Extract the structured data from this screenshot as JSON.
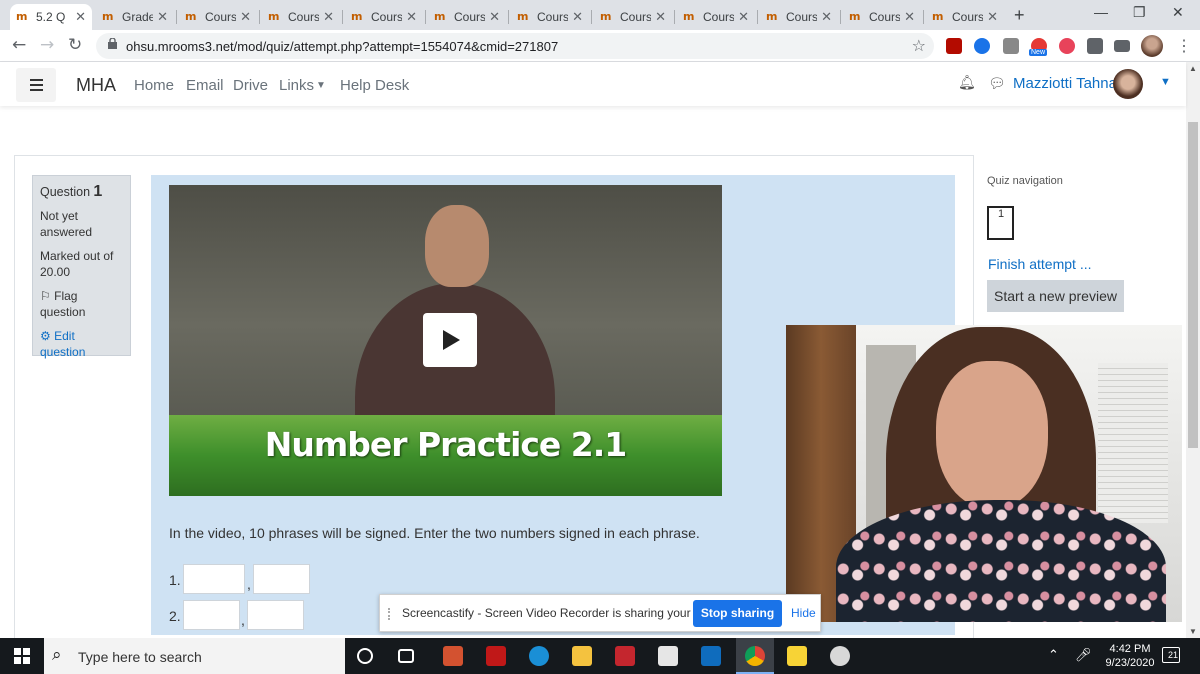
{
  "browser": {
    "tabs": [
      {
        "label": "5.2 Q"
      },
      {
        "label": "Grade"
      },
      {
        "label": "Cours"
      },
      {
        "label": "Cours"
      },
      {
        "label": "Cours"
      },
      {
        "label": "Cours"
      },
      {
        "label": "Cours"
      },
      {
        "label": "Cours"
      },
      {
        "label": "Cours"
      },
      {
        "label": "Cours"
      },
      {
        "label": "Cours"
      },
      {
        "label": "Cours"
      }
    ],
    "url": "ohsu.mrooms3.net/mod/quiz/attempt.php?attempt=1554074&cmid=271807",
    "ext_badge": "New"
  },
  "navbar": {
    "brand": "MHA",
    "links": [
      "Home",
      "Email",
      "Drive",
      "Links",
      "Help Desk"
    ],
    "username": "Mazziotti Tahna"
  },
  "question_info": {
    "label": "Question",
    "number": "1",
    "status": "Not yet answered",
    "marked": "Marked out of 20.00",
    "flag": "Flag question",
    "edit": "Edit question"
  },
  "video": {
    "title": "Number Practice 2.1"
  },
  "question": {
    "text": "In the video, 10 phrases will be signed. Enter the two numbers signed in each phrase.",
    "answers": [
      {
        "label": "1."
      },
      {
        "label": "2."
      }
    ]
  },
  "quiz_navigation": {
    "title": "Quiz navigation",
    "button": "1",
    "finish": "Finish attempt ...",
    "new_preview": "Start a new preview"
  },
  "sharebar": {
    "message": "Screencastify - Screen Video Recorder is sharing your screen.",
    "stop": "Stop sharing",
    "hide": "Hide"
  },
  "taskbar": {
    "search_placeholder": "Type here to search",
    "time": "4:42 PM",
    "date": "9/23/2020",
    "notifications": "21"
  },
  "colors": {
    "accent": "#0f6fc5",
    "question_bg": "#cfe2f3",
    "info_bg": "#dee2e6",
    "stop_button": "#1a73e8"
  }
}
